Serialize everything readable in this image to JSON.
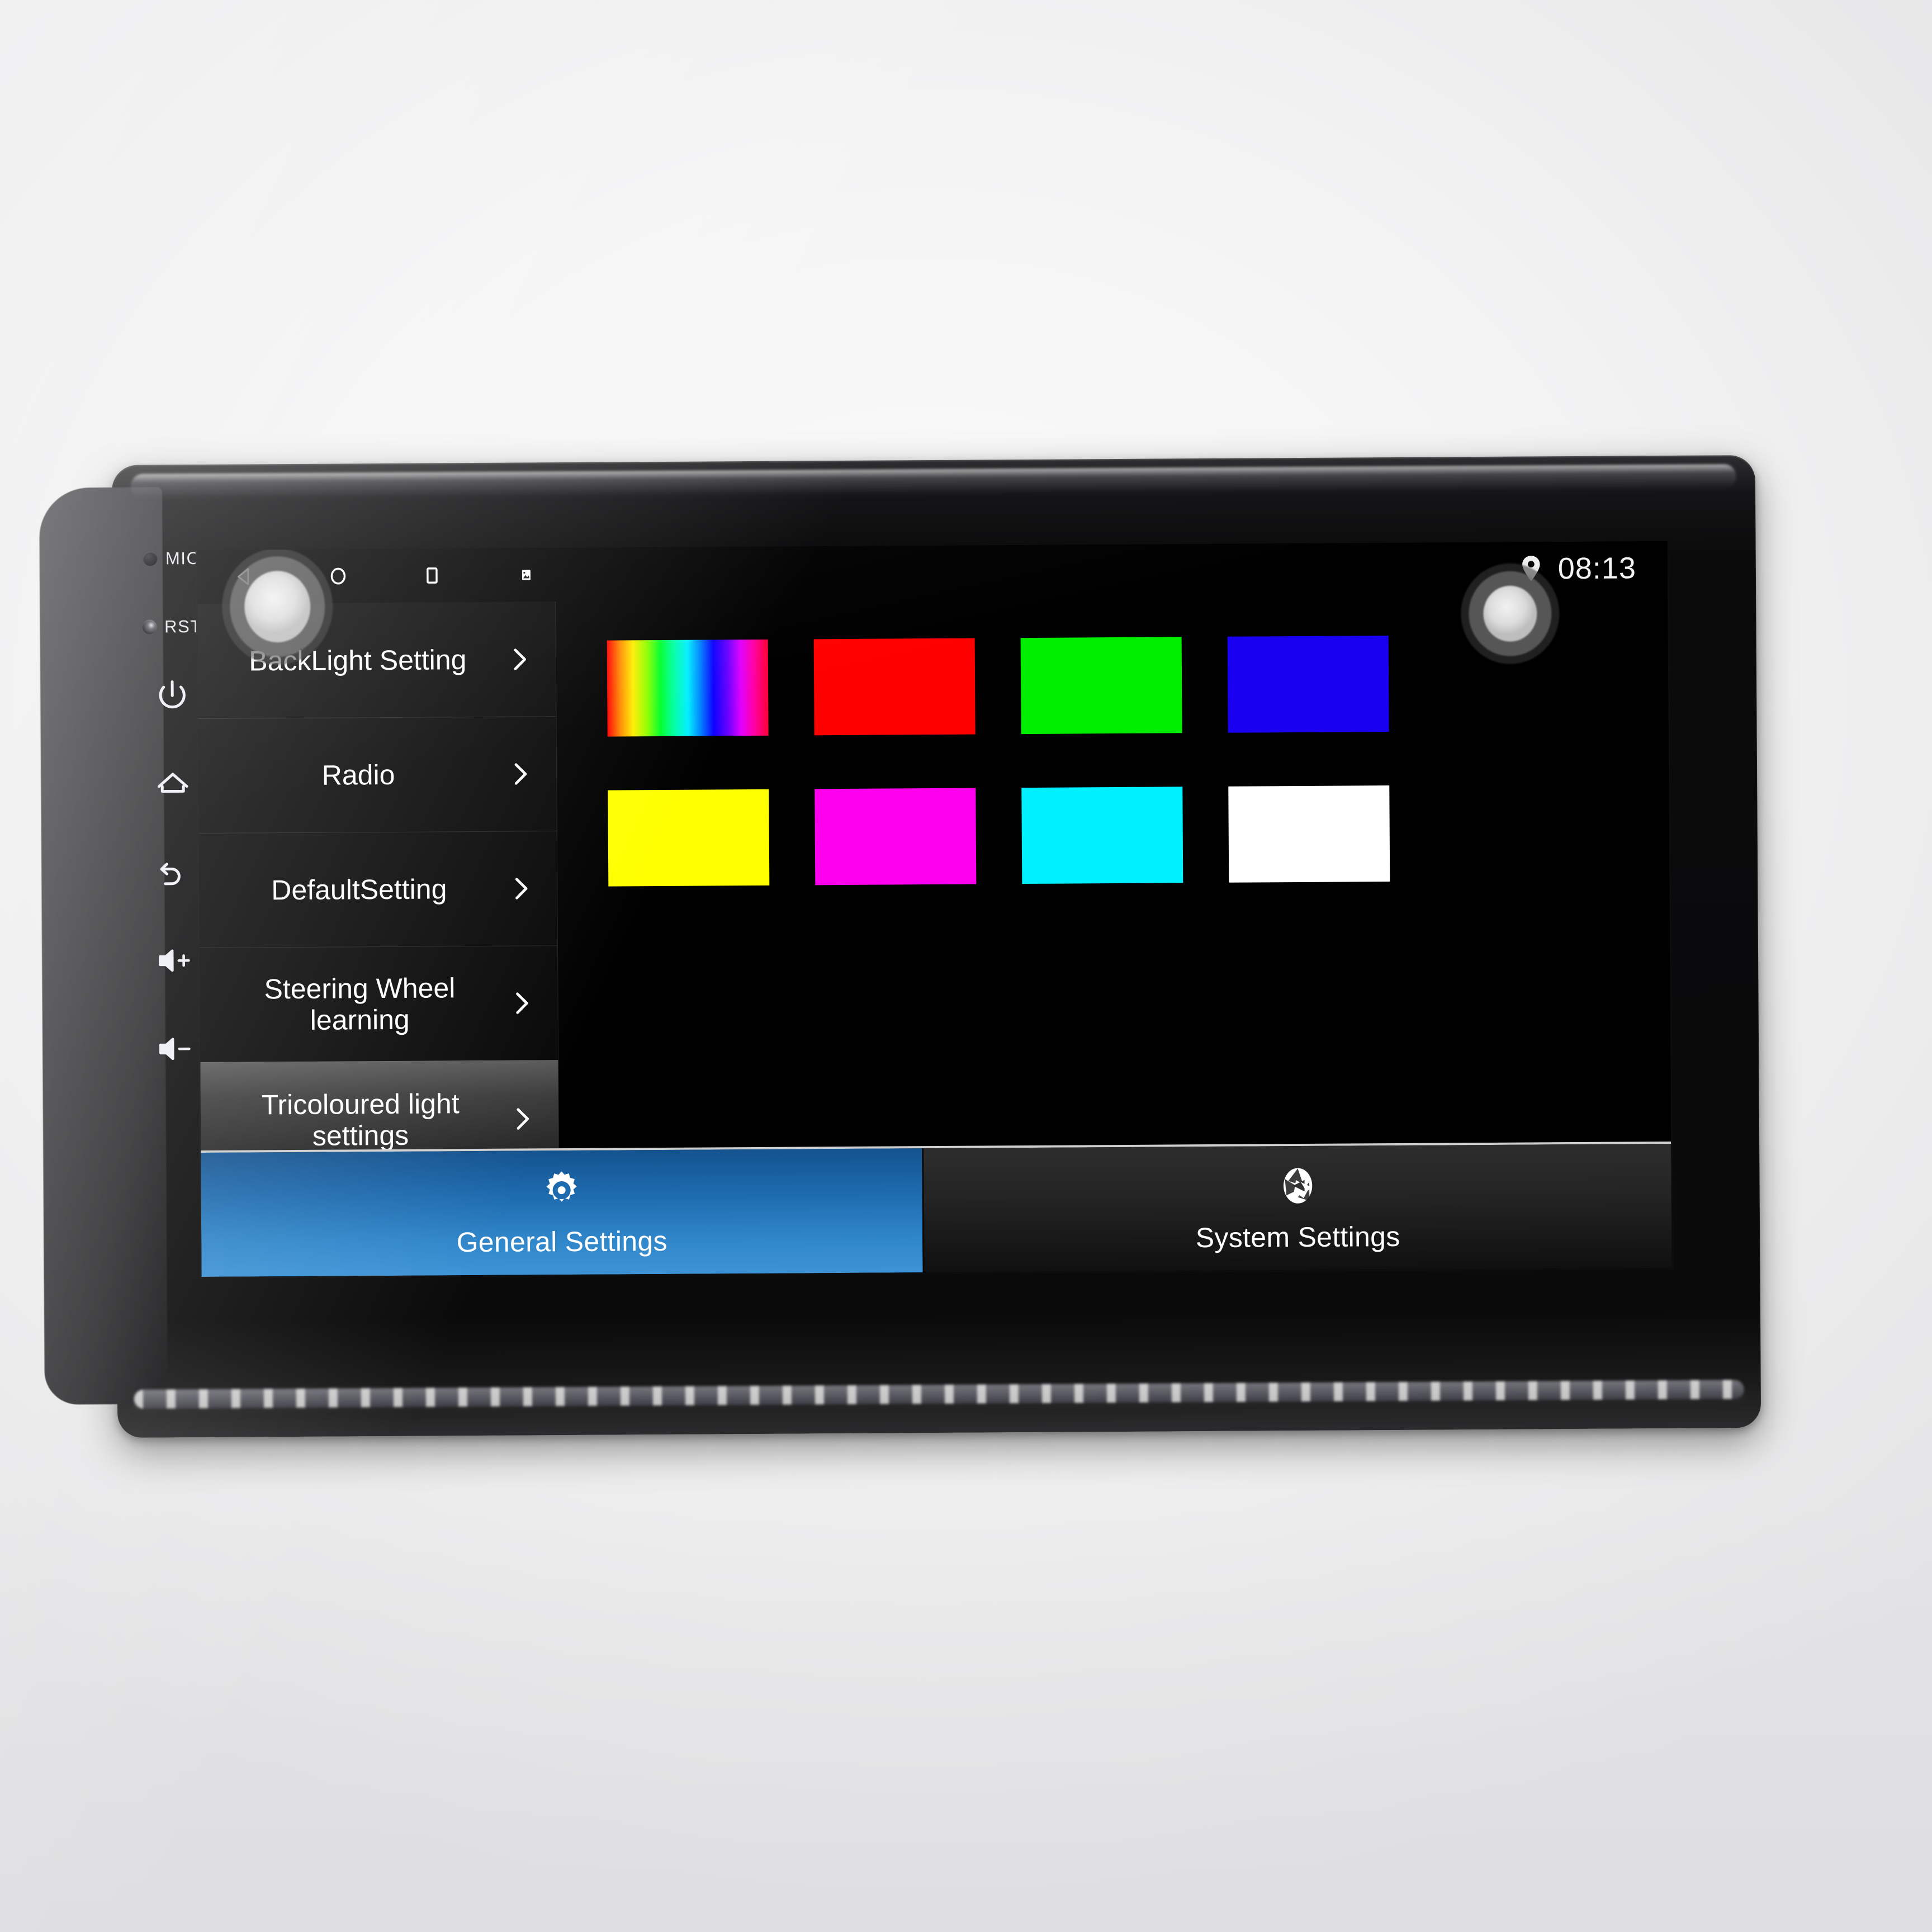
{
  "device": {
    "type": "car-head-unit-android",
    "bezel_controls": [
      {
        "name": "mic",
        "label": "MIC",
        "kind": "hole"
      },
      {
        "name": "reset",
        "label": "RST",
        "kind": "hole"
      },
      {
        "name": "power",
        "label": "",
        "kind": "power-icon"
      },
      {
        "name": "home",
        "label": "",
        "kind": "home-icon"
      },
      {
        "name": "back",
        "label": "",
        "kind": "back-arrow-icon"
      },
      {
        "name": "volume-up",
        "label": "",
        "kind": "volume-up-icon"
      },
      {
        "name": "volume-down",
        "label": "",
        "kind": "volume-down-icon"
      }
    ]
  },
  "statusbar": {
    "nav_icons": [
      "back-triangle-icon",
      "home-circle-icon",
      "recents-square-icon",
      "screenshot-image-icon"
    ],
    "location_icon": "location-pin-icon",
    "clock": "08:13"
  },
  "menu": {
    "items": [
      {
        "label": "BackLight Setting",
        "selected": false,
        "chevron": "chevron-right-icon"
      },
      {
        "label": "Radio",
        "selected": false,
        "chevron": "chevron-right-icon"
      },
      {
        "label": "DefaultSetting",
        "selected": false,
        "chevron": "chevron-right-icon"
      },
      {
        "label": "Steering Wheel learning",
        "selected": false,
        "chevron": "chevron-right-icon"
      },
      {
        "label": "Tricoloured light settings",
        "selected": true,
        "chevron": "chevron-right-icon"
      }
    ]
  },
  "panel": {
    "title": "Tricoloured light settings",
    "swatches": [
      {
        "name": "rainbow",
        "color": "rainbow-gradient"
      },
      {
        "name": "red",
        "color": "#ff0000"
      },
      {
        "name": "green",
        "color": "#00ee00"
      },
      {
        "name": "blue",
        "color": "#1a00f0"
      },
      {
        "name": "yellow",
        "color": "#ffff00"
      },
      {
        "name": "magenta",
        "color": "#ff00ee"
      },
      {
        "name": "cyan",
        "color": "#00f0ff"
      },
      {
        "name": "white",
        "color": "#ffffff"
      }
    ]
  },
  "tabs": [
    {
      "id": "general",
      "label": "General Settings",
      "icon": "gear-icon",
      "active": true,
      "accent": "#2f86c9"
    },
    {
      "id": "system",
      "label": "System Settings",
      "icon": "aperture-icon",
      "active": false,
      "accent": "#1f1f1f"
    }
  ]
}
